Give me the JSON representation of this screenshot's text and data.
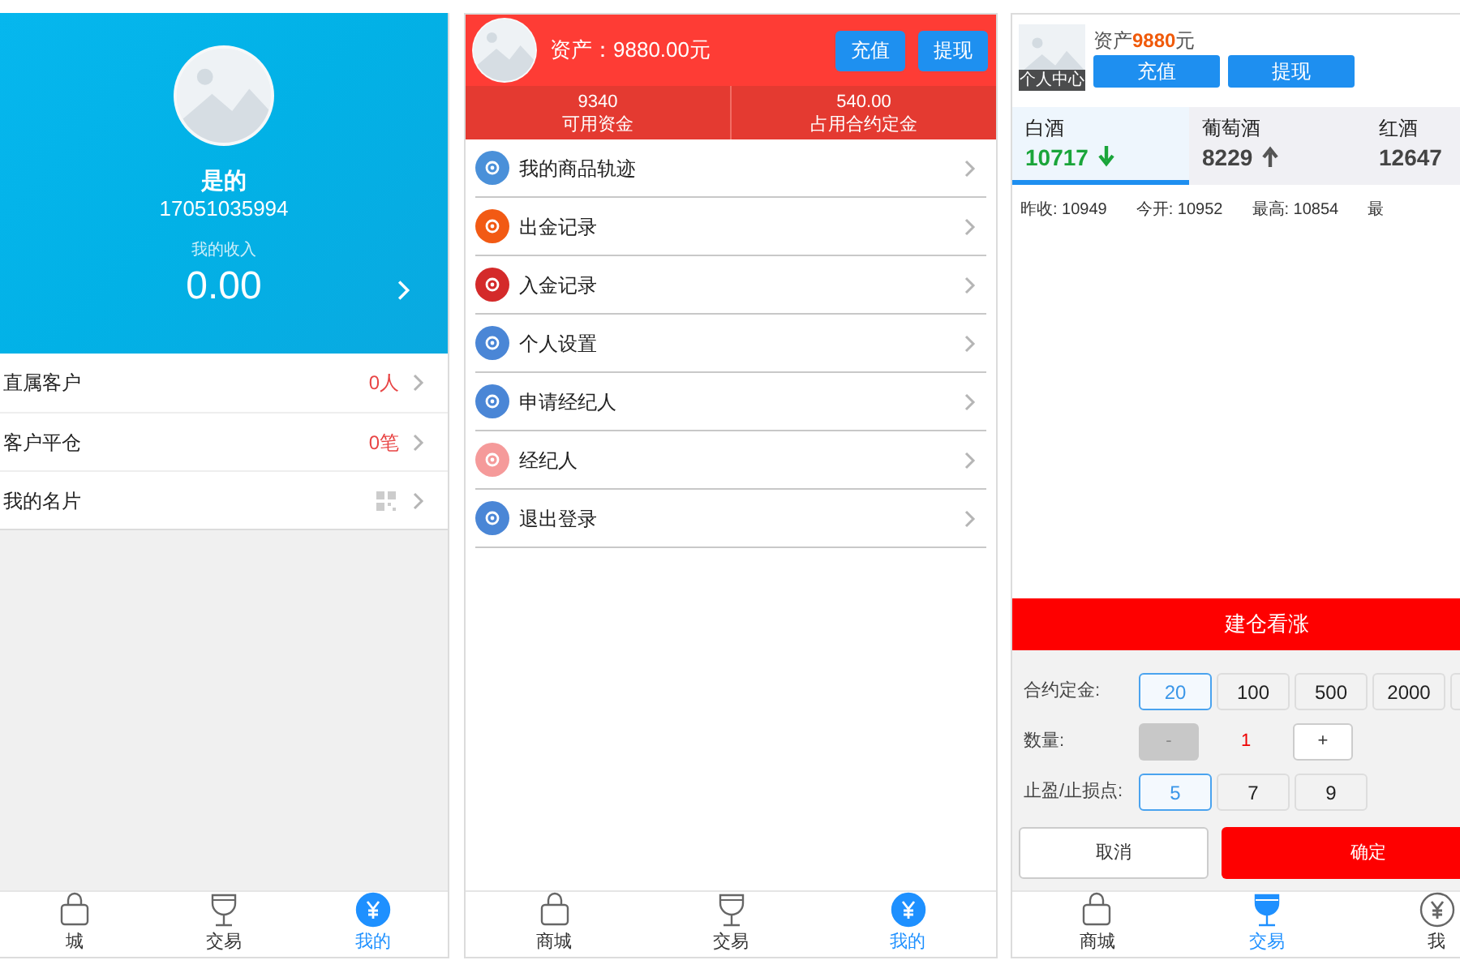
{
  "agent_screen": {
    "name": "是的",
    "phone": "17051035994",
    "income_label": "我的收入",
    "income": "0.00",
    "rows": [
      {
        "kind": "count",
        "label": "直属客户",
        "value": "0人"
      },
      {
        "kind": "count",
        "label": "客户平仓",
        "value": "0笔"
      },
      {
        "kind": "qr",
        "label": "我的名片"
      }
    ],
    "tab_bar": [
      {
        "kind": "shop",
        "label": "城",
        "selected": false
      },
      {
        "kind": "trade",
        "label": "交易",
        "selected": false
      },
      {
        "kind": "mine",
        "label": "我的",
        "selected": true
      }
    ]
  },
  "account_screen": {
    "assets": "资产：9880.00元",
    "buttons": [
      "充值",
      "提现"
    ],
    "stats": [
      {
        "value": "9340",
        "label": "可用资金"
      },
      {
        "value": "540.00",
        "label": "占用合约定金"
      }
    ],
    "menu": [
      {
        "label": "我的商品轨迹",
        "color": "#4a90d9"
      },
      {
        "label": "出金记录",
        "color": "#f25a14"
      },
      {
        "label": "入金记录",
        "color": "#d42a2a"
      },
      {
        "label": "个人设置",
        "color": "#4a86d6"
      },
      {
        "label": "申请经纪人",
        "color": "#4a86d6"
      },
      {
        "label": "经纪人",
        "color": "#f59a9a"
      },
      {
        "label": "退出登录",
        "color": "#4a86d6"
      }
    ],
    "tab_bar": [
      {
        "kind": "shop",
        "label": "商城",
        "selected": false
      },
      {
        "kind": "trade",
        "label": "交易",
        "selected": false
      },
      {
        "kind": "mine",
        "label": "我的",
        "selected": true
      }
    ]
  },
  "trade_screen": {
    "avatar_label": "个人中心",
    "assets_label": "资产",
    "assets_value": "9880",
    "assets_unit": "元",
    "buttons": [
      "充值",
      "提现"
    ],
    "products": [
      {
        "name": "白酒",
        "price": "10717",
        "falling": true,
        "selected": true
      },
      {
        "name": "葡萄酒",
        "price": "8229",
        "falling": false,
        "selected": false
      },
      {
        "name": "红酒",
        "price": "12647",
        "selected": false
      }
    ],
    "quotes": [
      {
        "label": "昨收:",
        "value": "10949"
      },
      {
        "label": "今开:",
        "value": "10952"
      },
      {
        "label": "最高:",
        "value": "10854"
      },
      {
        "label": "最"
      }
    ],
    "order_title": "建仓看涨",
    "deposit_label": "合约定金:",
    "deposits": [
      {
        "label": "20",
        "selected": true
      },
      {
        "label": "100",
        "selected": false
      },
      {
        "label": "500",
        "selected": false
      },
      {
        "label": "2000",
        "selected": false
      },
      {
        "selected": false
      }
    ],
    "quantity_label": "数量:",
    "minus": "-",
    "minus_disabled": true,
    "quantity": "1",
    "plus": "+",
    "points_label": "止盈/止损点:",
    "points": [
      {
        "label": "5",
        "selected": true
      },
      {
        "label": "7",
        "selected": false
      },
      {
        "label": "9",
        "selected": false
      }
    ],
    "cancel": "取消",
    "confirm": "确定",
    "tab_bar": [
      {
        "kind": "shop",
        "label": "商城",
        "selected": false
      },
      {
        "kind": "trade",
        "label": "交易",
        "selected": true
      },
      {
        "kind": "mine",
        "label": "我"
      }
    ]
  }
}
